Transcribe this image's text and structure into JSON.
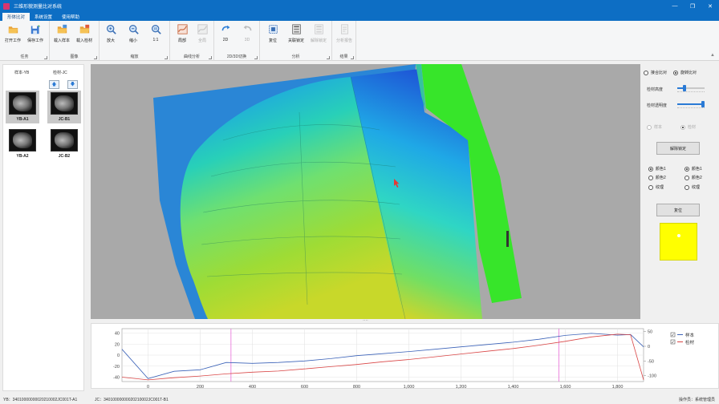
{
  "window": {
    "title": "三维形貌测量比对系统",
    "controls": [
      "—",
      "❐",
      "✕"
    ]
  },
  "menu": {
    "tabs": [
      {
        "label": "形体比对",
        "active": true
      },
      {
        "label": "系统设置",
        "active": false
      },
      {
        "label": "使用帮助",
        "active": false
      }
    ]
  },
  "ribbon": {
    "groups": [
      {
        "name": "任务",
        "buttons": [
          {
            "label": "打开工作",
            "icon": "folder-open-icon"
          },
          {
            "label": "保存工作",
            "icon": "save-icon"
          }
        ]
      },
      {
        "name": "图像",
        "buttons": [
          {
            "label": "载入样本",
            "icon": "load-sample-icon"
          },
          {
            "label": "载入检材",
            "icon": "load-material-icon"
          }
        ]
      },
      {
        "name": "缩放",
        "buttons": [
          {
            "label": "放大",
            "icon": "zoom-in-icon"
          },
          {
            "label": "缩小",
            "icon": "zoom-out-icon"
          },
          {
            "label": "1:1",
            "icon": "zoom-actual-icon"
          }
        ]
      },
      {
        "name": "曲线分析",
        "buttons": [
          {
            "label": "局部",
            "icon": "local-curve-icon"
          },
          {
            "label": "全局",
            "icon": "global-curve-icon",
            "disabled": true
          }
        ]
      },
      {
        "name": "2D/3D切换",
        "buttons": [
          {
            "label": "2D",
            "icon": "switch-2d-icon"
          },
          {
            "label": "3D",
            "icon": "switch-3d-icon",
            "disabled": true
          }
        ]
      },
      {
        "name": "分析",
        "buttons": [
          {
            "label": "复位",
            "icon": "reset-view-icon"
          },
          {
            "label": "关联锁定",
            "icon": "link-lock-icon"
          },
          {
            "label": "解除锁定",
            "icon": "unlock-icon",
            "disabled": true
          }
        ]
      },
      {
        "name": "结果",
        "buttons": [
          {
            "label": "分析报告",
            "icon": "report-icon",
            "disabled": true
          }
        ]
      }
    ]
  },
  "left_panel": {
    "sample_header": "样本-YB",
    "material_header": "检材-JC",
    "thumbnails": [
      {
        "name": "YB-A1",
        "selected": true
      },
      {
        "name": "JC-B1",
        "selected": true
      },
      {
        "name": "YB-A2",
        "selected": false
      },
      {
        "name": "JC-B2",
        "selected": false
      }
    ]
  },
  "right_panel": {
    "mode_options": [
      {
        "label": "接合比对",
        "checked": false
      },
      {
        "label": "旋转比对",
        "checked": true
      }
    ],
    "material_height_label": "检材高度",
    "material_height_value": 0.25,
    "material_opacity_label": "检材透明度",
    "material_opacity_value": 0.95,
    "target_options": [
      {
        "label": "样本",
        "checked": false,
        "disabled": true
      },
      {
        "label": "检材",
        "checked": true,
        "disabled": true
      }
    ],
    "unlock_button": "解除锁定",
    "left_colors": [
      {
        "label": "颜色1",
        "checked": true
      },
      {
        "label": "颜色2",
        "checked": false
      },
      {
        "label": "纹理",
        "checked": false
      }
    ],
    "right_colors": [
      {
        "label": "颜色1",
        "checked": true
      },
      {
        "label": "颜色2",
        "checked": false
      },
      {
        "label": "纹理",
        "checked": false
      }
    ],
    "reset_button": "复位",
    "swatch_color": "#ffff00"
  },
  "chart_data": {
    "type": "line",
    "x": [
      -100,
      0,
      100,
      200,
      300,
      400,
      500,
      600,
      700,
      800,
      900,
      1000,
      1100,
      1200,
      1300,
      1400,
      1500,
      1600,
      1700,
      1800,
      1850,
      1900
    ],
    "x_ticks": [
      0,
      200,
      400,
      600,
      800,
      1000,
      1200,
      1400,
      1600,
      1800
    ],
    "xlim": [
      -100,
      1900
    ],
    "y_left_ticks": [
      40,
      20,
      0,
      -20,
      -40
    ],
    "ylim_left": [
      -48,
      48
    ],
    "y_right_ticks": [
      50,
      0,
      -50,
      -100
    ],
    "ylim_right": [
      -120,
      60
    ],
    "series": [
      {
        "name": "样本",
        "color": "#3b62b8",
        "axis": "right",
        "values": [
          -10,
          -110,
          -85,
          -80,
          -55,
          -58,
          -55,
          -50,
          -42,
          -32,
          -25,
          -18,
          -10,
          -2,
          6,
          14,
          24,
          37,
          44,
          38,
          40,
          -2
        ]
      },
      {
        "name": "检材",
        "color": "#d94545",
        "axis": "left",
        "values": [
          -40,
          -45,
          -41,
          -38,
          -34,
          -31,
          -29,
          -25,
          -21,
          -17,
          -12,
          -8,
          -3,
          2,
          7,
          12,
          18,
          25,
          33,
          38,
          37,
          -45
        ]
      }
    ],
    "vlines": [
      318,
      1575
    ],
    "vline_color": "#e86bd8",
    "legend": "right"
  },
  "status": {
    "yb": "YB：34010000000020210002JC001T-A1",
    "jc": "JC：34010000000020210002JC001T-B1",
    "operator": "操作员：系统管理员"
  }
}
